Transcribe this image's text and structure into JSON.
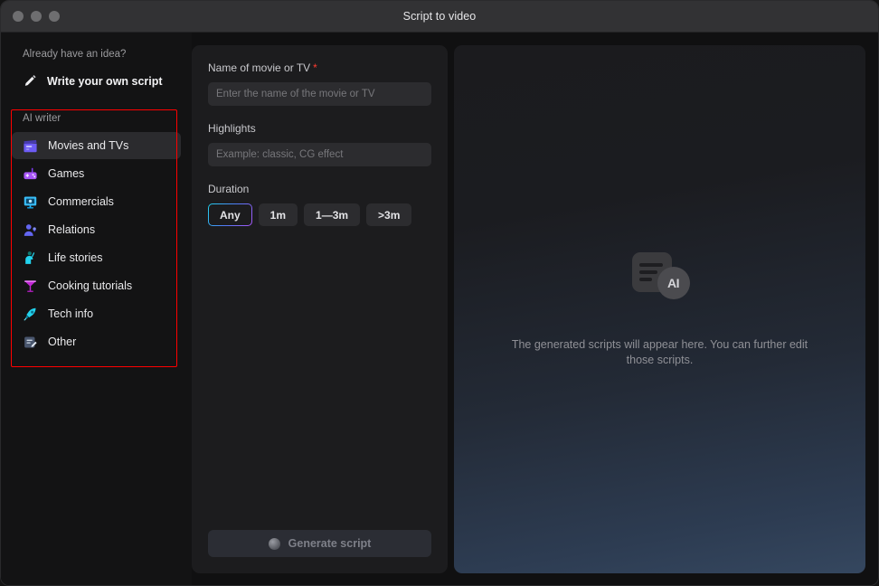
{
  "window": {
    "title": "Script to video",
    "traffic_lights": [
      "close",
      "minimize",
      "maximize"
    ]
  },
  "sidebar": {
    "idea_caption": "Already have an idea?",
    "own_script": {
      "label": "Write your own script",
      "icon": "pencil-icon"
    },
    "ai_writer_caption": "AI writer",
    "items": [
      {
        "label": "Movies and TVs",
        "icon": "clapperboard-icon",
        "color": "#6d5cf5",
        "selected": true
      },
      {
        "label": "Games",
        "icon": "gamepad-icon",
        "color": "#a855f7",
        "selected": false
      },
      {
        "label": "Commercials",
        "icon": "monitor-icon",
        "color": "#38bdf8",
        "selected": false
      },
      {
        "label": "Relations",
        "icon": "person-icon",
        "color": "#6366f1",
        "selected": false
      },
      {
        "label": "Life stories",
        "icon": "figure-icon",
        "color": "#22d3ee",
        "selected": false
      },
      {
        "label": "Cooking tutorials",
        "icon": "cocktail-icon",
        "color": "#c026d3",
        "selected": false
      },
      {
        "label": "Tech info",
        "icon": "rocket-icon",
        "color": "#22d3ee",
        "selected": false
      },
      {
        "label": "Other",
        "icon": "note-edit-icon",
        "color": "#5b6e8f",
        "selected": false
      }
    ],
    "annotation_color": "#ff0000"
  },
  "form": {
    "name_label": "Name of movie or TV",
    "name_required_mark": "*",
    "name_value": "",
    "name_placeholder": "Enter the name of the movie or TV",
    "highlights_label": "Highlights",
    "highlights_value": "",
    "highlights_placeholder": "Example: classic, CG effect",
    "duration_label": "Duration",
    "duration_options": [
      {
        "label": "Any",
        "selected": true
      },
      {
        "label": "1m",
        "selected": false
      },
      {
        "label": "1—3m",
        "selected": false
      },
      {
        "label": ">3m",
        "selected": false
      }
    ],
    "generate_button": {
      "label": "Generate script",
      "icon": "orb-icon",
      "disabled": true
    }
  },
  "preview": {
    "placeholder_icon": "ai-document-icon",
    "badge_text": "AI",
    "empty_message": "The generated scripts will appear here. You can further edit those scripts."
  }
}
